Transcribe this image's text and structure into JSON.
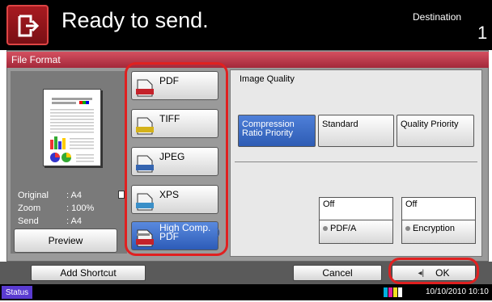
{
  "header": {
    "title": "Ready to send.",
    "destination_label": "Destination",
    "destination_count": "1"
  },
  "panel": {
    "title": "File Format"
  },
  "preview": {
    "original_label": "Original",
    "original_value": ": A4",
    "zoom_label": "Zoom",
    "zoom_value": ": 100%",
    "send_label": "Send",
    "send_value": ": A4",
    "preview_button": "Preview"
  },
  "formats": [
    {
      "label": "PDF",
      "icon": "pdf-file-icon",
      "selected": false
    },
    {
      "label": "TIFF",
      "icon": "tiff-file-icon",
      "selected": false
    },
    {
      "label": "JPEG",
      "icon": "jpeg-file-icon",
      "selected": false
    },
    {
      "label": "XPS",
      "icon": "xps-file-icon",
      "selected": false
    },
    {
      "label": "High Comp. PDF",
      "icon": "high-comp-pdf-icon",
      "selected": true
    }
  ],
  "settings": {
    "image_quality_label": "Image Quality",
    "options": [
      {
        "label": "Compression Ratio Priority",
        "selected": true
      },
      {
        "label": "Standard",
        "selected": false
      },
      {
        "label": "Quality Priority",
        "selected": false
      }
    ],
    "pdfa_value": "Off",
    "pdfa_label": "PDF/A",
    "encryption_value": "Off",
    "encryption_label": "Encryption"
  },
  "bottom": {
    "add_shortcut": "Add Shortcut",
    "cancel": "Cancel",
    "ok": "OK"
  },
  "status": {
    "status_button": "Status",
    "datetime": "10/10/2010  10:10"
  },
  "colors": {
    "selected_blue": "#2d5cb8",
    "header_red": "#a81a20",
    "highlight_outline": "#e02020"
  }
}
